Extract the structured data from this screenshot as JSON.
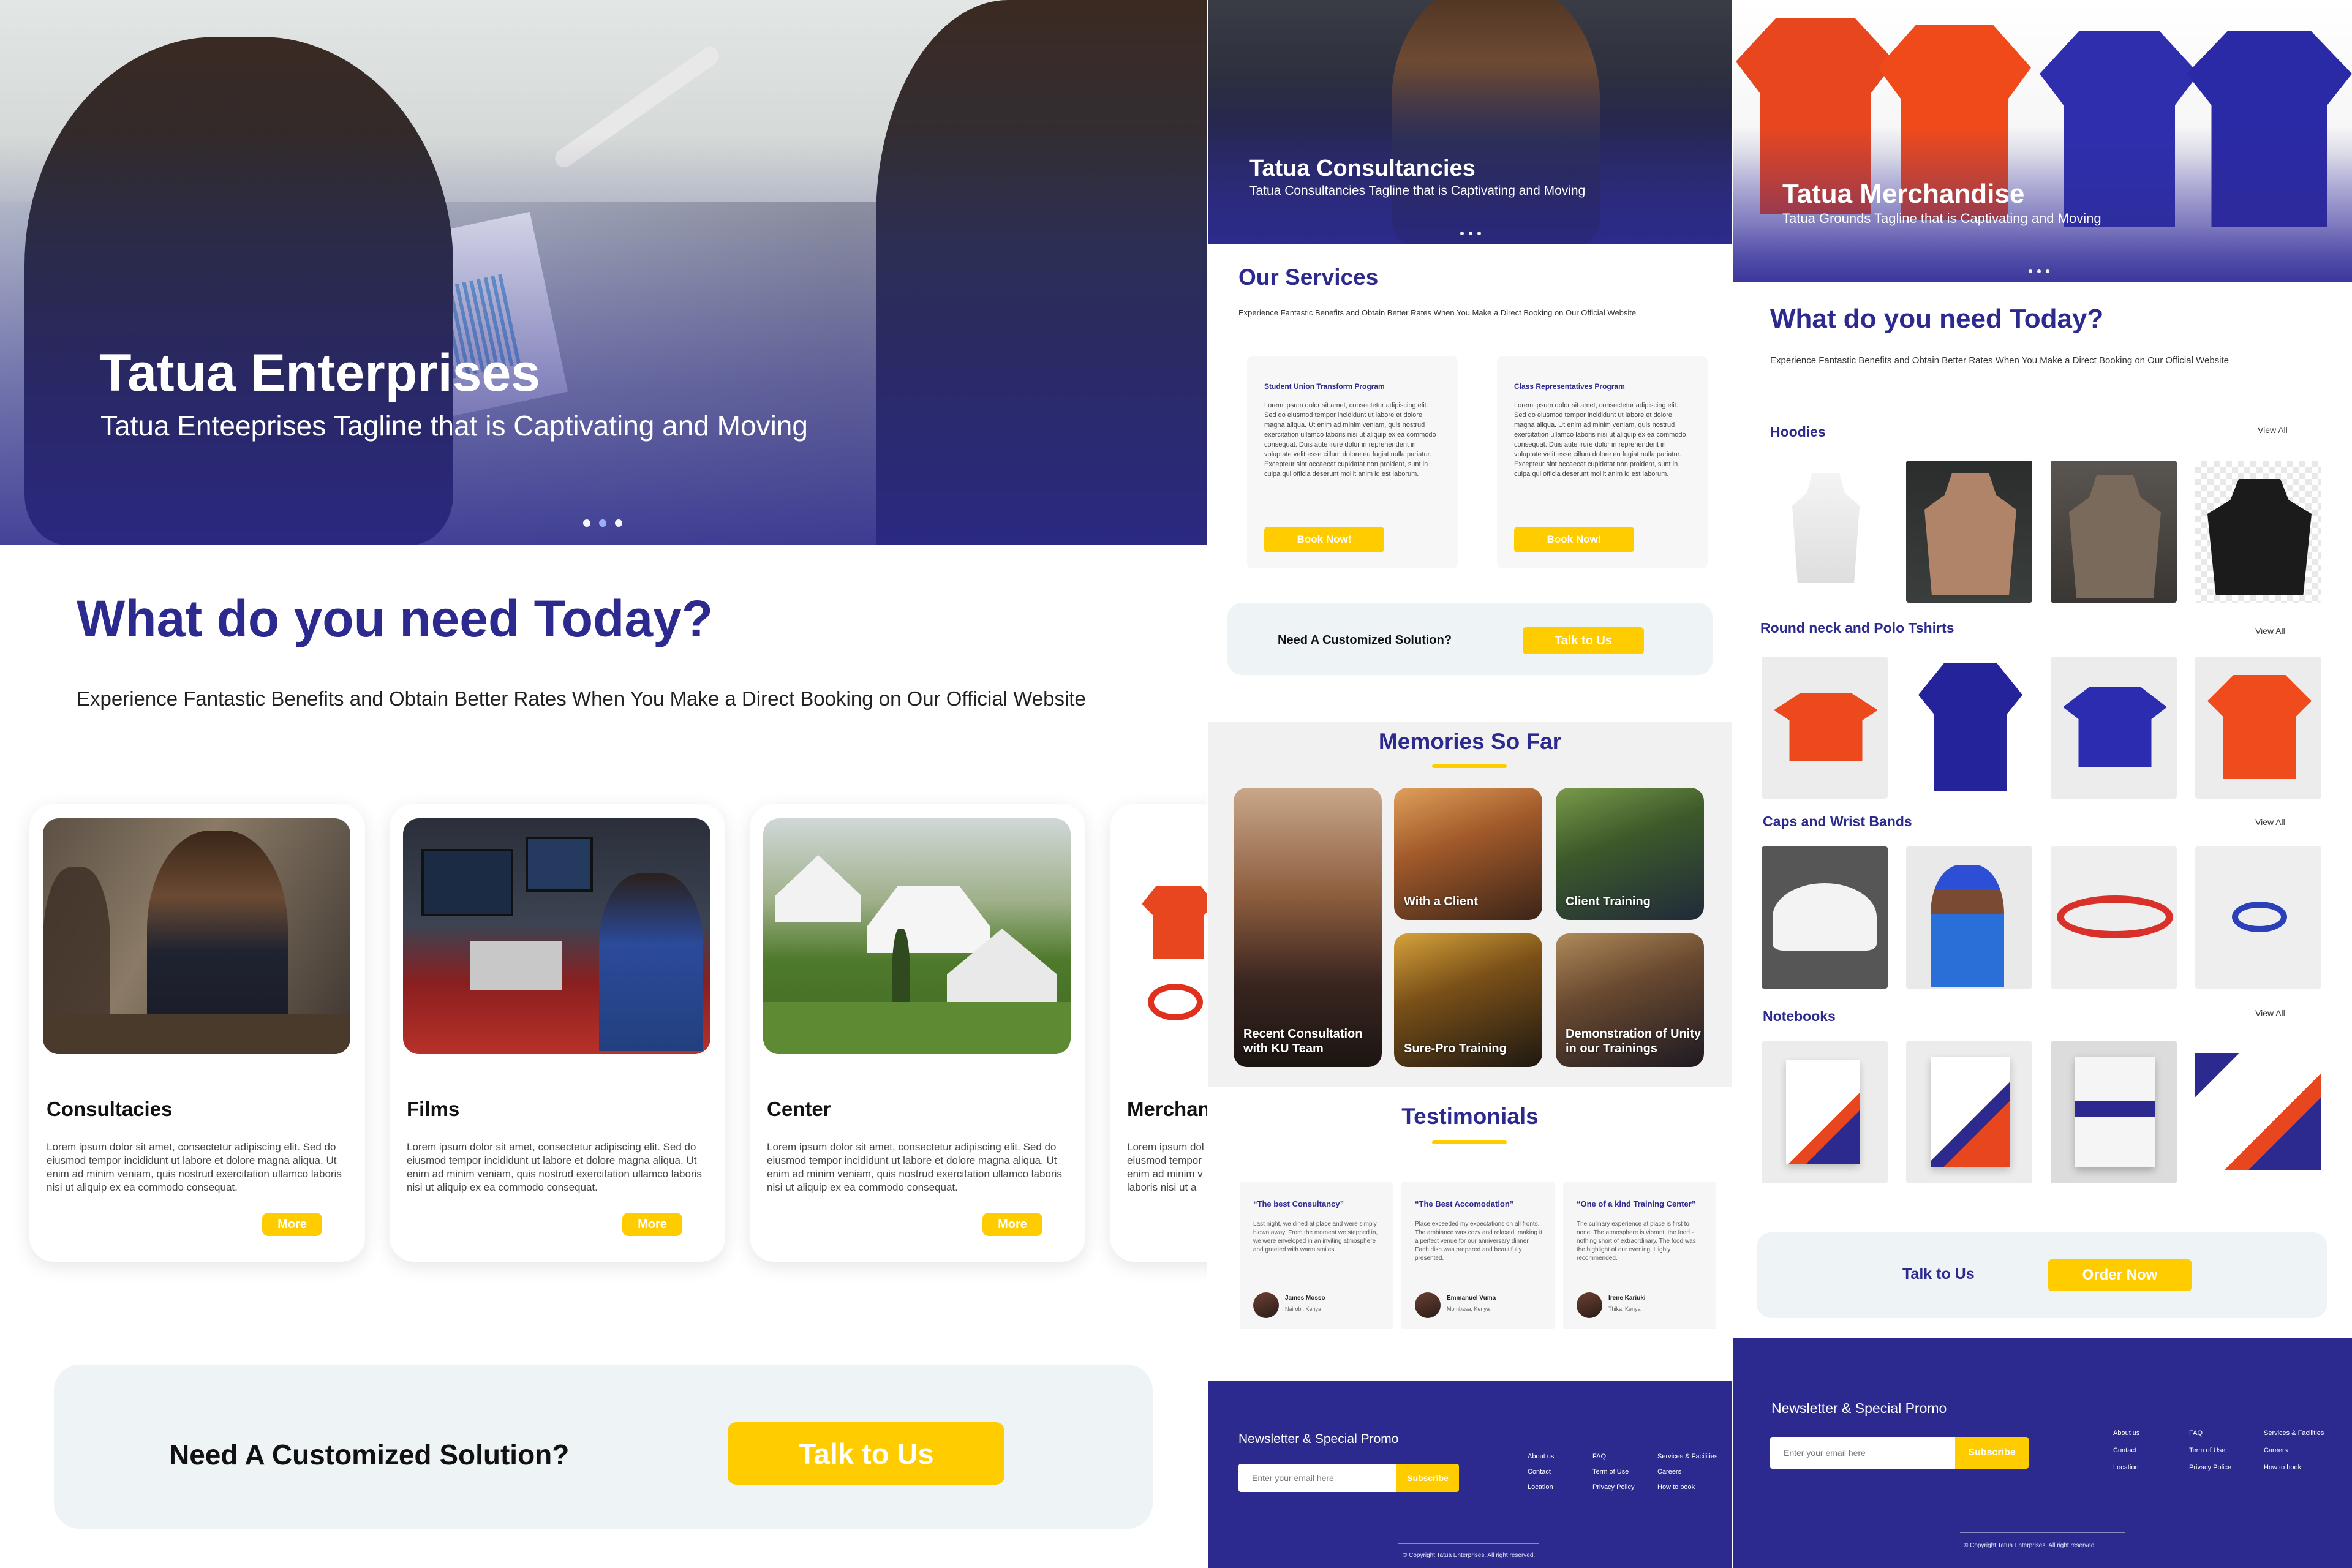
{
  "colors": {
    "navy": "#2D2A8F",
    "yellow": "#FFCC00",
    "light_panel": "#EEF3F5"
  },
  "panel1": {
    "hero": {
      "title": "Tatua Enterprises",
      "tagline": "Tatua Enteeprises Tagline that is Captivating and Moving"
    },
    "heading": "What do you need Today?",
    "subheading": "Experience Fantastic Benefits and Obtain Better Rates When You Make a Direct Booking on Our Official Website",
    "cards": [
      {
        "title": "Consultacies",
        "desc": "Lorem ipsum dolor sit amet, consectetur adipiscing elit. Sed do eiusmod tempor incididunt ut labore et dolore magna aliqua. Ut enim ad minim veniam, quis nostrud exercitation ullamco laboris nisi ut aliquip ex ea commodo consequat.",
        "button": "More"
      },
      {
        "title": "Films",
        "desc": "Lorem ipsum dolor sit amet, consectetur adipiscing elit. Sed do eiusmod tempor incididunt ut labore et dolore magna aliqua. Ut enim ad minim veniam, quis nostrud exercitation ullamco laboris nisi ut aliquip ex ea commodo consequat.",
        "button": "More"
      },
      {
        "title": "Center",
        "desc": "Lorem ipsum dolor sit amet, consectetur adipiscing elit. Sed do eiusmod tempor incididunt ut labore et dolore magna aliqua. Ut enim ad minim veniam, quis nostrud exercitation ullamco laboris nisi ut aliquip ex ea commodo consequat.",
        "button": "More"
      },
      {
        "title": "Merchan",
        "desc": "Lorem ipsum dol eiusmod tempor enim ad minim v laboris nisi ut a"
      }
    ],
    "cta": {
      "text": "Need A Customized Solution?",
      "button": "Talk to Us"
    }
  },
  "panel2": {
    "hero": {
      "title": "Tatua Consultancies",
      "tagline": "Tatua Consultancies Tagline that is Captivating and Moving"
    },
    "services_heading": "Our Services",
    "services_sub": "Experience Fantastic Benefits and Obtain Better Rates When You Make a Direct Booking on Our Official Website",
    "services": [
      {
        "title": "Student Union Transform Program",
        "desc": "Lorem ipsum dolor sit amet, consectetur adipiscing elit. Sed do eiusmod tempor incididunt ut labore et dolore magna aliqua. Ut enim ad minim veniam, quis nostrud exercitation ullamco laboris nisi ut aliquip ex ea commodo consequat. Duis aute irure dolor in reprehenderit in voluptate velit esse cillum dolore eu fugiat nulla pariatur. Excepteur sint occaecat cupidatat non proident, sunt in culpa qui officia deserunt mollit anim id est laborum.",
        "button": "Book Now!"
      },
      {
        "title": "Class Representatives Program",
        "desc": "Lorem ipsum dolor sit amet, consectetur adipiscing elit. Sed do eiusmod tempor incididunt ut labore et dolore magna aliqua. Ut enim ad minim veniam, quis nostrud exercitation ullamco laboris nisi ut aliquip ex ea commodo consequat. Duis aute irure dolor in reprehenderit in voluptate velit esse cillum dolore eu fugiat nulla pariatur. Excepteur sint occaecat cupidatat non proident, sunt in culpa qui officia deserunt mollit anim id est laborum.",
        "button": "Book Now!"
      }
    ],
    "cta": {
      "text": "Need A Customized Solution?",
      "button": "Talk to Us"
    },
    "memories_heading": "Memories So Far",
    "memories": [
      {
        "label": "Recent Consultation with KU Team"
      },
      {
        "label": "With a Client"
      },
      {
        "label": "Client Training"
      },
      {
        "label": "Sure-Pro Training"
      },
      {
        "label": "Demonstration of Unity in our Trainings"
      }
    ],
    "testimonials_heading": "Testimonials",
    "testimonials": [
      {
        "quote": "“The best Consultancy”",
        "body": "Last night, we dined at place and were simply blown away. From the moment we stepped in, we were enveloped in an inviting atmosphere and greeted with warm smiles.",
        "name": "James Mosso",
        "location": "Nairobi, Kenya"
      },
      {
        "quote": "“The Best Accomodation”",
        "body": "Place exceeded my expectations on all fronts. The ambiance was cozy and relaxed, making it a perfect venue for our anniversary dinner. Each dish was prepared and beautifully presented.",
        "name": "Emmanuel Vuma",
        "location": "Mombasa, Kenya"
      },
      {
        "quote": "“One of a kind Training Center”",
        "body": "The culinary experience at place is first to none. The atmosphere is vibrant, the food - nothing short of extraordinary. The food was the highlight of our evening. Highly recommended.",
        "name": "Irene Kariuki",
        "location": "Thika, Kenya"
      }
    ],
    "footer": {
      "newsletter": "Newsletter & Special Promo",
      "placeholder": "Enter your email here",
      "subscribe": "Subscribe",
      "col1": [
        "About us",
        "Contact",
        "Location"
      ],
      "col2": [
        "FAQ",
        "Term of Use",
        "Privacy Policy"
      ],
      "col3": [
        "Services & Facilities",
        "Careers",
        "How to book"
      ],
      "copyright": "© Copyright Tatua Enterprises. All right reserved."
    }
  },
  "panel3": {
    "hero": {
      "title": "Tatua Merchandise",
      "tagline": "Tatua Grounds Tagline that is Captivating and Moving"
    },
    "heading": "What do you need Today?",
    "subheading": "Experience Fantastic Benefits and Obtain Better Rates When You Make a Direct Booking on Our Official Website",
    "categories": [
      {
        "title": "Hoodies",
        "view_all": "View All"
      },
      {
        "title": "Round neck and Polo Tshirts",
        "view_all": "View All"
      },
      {
        "title": "Caps and Wrist Bands",
        "view_all": "View All"
      },
      {
        "title": "Notebooks",
        "view_all": "View All"
      }
    ],
    "cta": {
      "talk": "Talk to Us",
      "order": "Order Now"
    },
    "footer": {
      "newsletter": "Newsletter & Special Promo",
      "placeholder": "Enter your email here",
      "subscribe": "Subscribe",
      "col1": [
        "About us",
        "Contact",
        "Location"
      ],
      "col2": [
        "FAQ",
        "Term of Use",
        "Privacy Police"
      ],
      "col3": [
        "Services & Facilities",
        "Careers",
        "How to book"
      ],
      "copyright": "© Copyright Tatua Enterprises. All right reserved."
    }
  }
}
